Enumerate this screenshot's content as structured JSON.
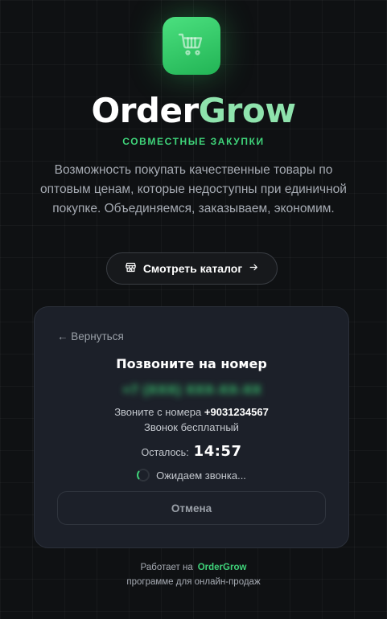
{
  "header": {
    "icon": "shopping-cart-icon",
    "brand_part1": "Order",
    "brand_part2": "Grow",
    "tagline": "СОВМЕСТНЫЕ ЗАКУПКИ",
    "description": "Возможность покупать качественные товары по оптовым ценам, которые недоступны при единичной покупке. Объединяемся, заказываем, экономим.",
    "catalog_button": "Смотреть каталог",
    "accent_color": "#3fd47a"
  },
  "call_card": {
    "back_label": "← Вернуться",
    "title": "Позвоните на номер",
    "phone_number": "+7 (XXX) XXX-XX-XX",
    "from_prefix": "Звоните с номера",
    "from_number": "+9031234567",
    "free_note": "Звонок бесплатный",
    "timer_label": "Осталось:",
    "timer_value": "14:57",
    "waiting_text": "Ожидаем звонка...",
    "cancel_label": "Отмена"
  },
  "footer": {
    "powered_prefix": "Работает на",
    "powered_brand": "OrderGrow",
    "powered_suffix": "программе для онлайн-продаж"
  }
}
